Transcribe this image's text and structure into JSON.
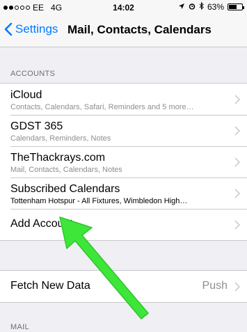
{
  "status_bar": {
    "carrier": "EE",
    "network": "4G",
    "time": "14:02",
    "battery": "63%",
    "battery_level": 0.63,
    "icons": [
      "location-arrow-icon",
      "alarm-icon",
      "bluetooth-icon"
    ]
  },
  "nav": {
    "back_label": "Settings",
    "title": "Mail, Contacts, Calendars"
  },
  "accounts": {
    "header": "ACCOUNTS",
    "items": [
      {
        "title": "iCloud",
        "subtitle": "Contacts, Calendars, Safari, Reminders and 5 more…"
      },
      {
        "title": "GDST 365",
        "subtitle": "Calendars, Reminders, Notes"
      },
      {
        "title": "TheThackrays.com",
        "subtitle": "Mail, Contacts, Calendars, Notes"
      },
      {
        "title": "Subscribed Calendars",
        "subtitle": "Tottenham Hotspur - All Fixtures, Wimbledon High…"
      },
      {
        "title": "Add Account"
      }
    ]
  },
  "fetch": {
    "label": "Fetch New Data",
    "value": "Push"
  },
  "mail_section": {
    "header": "MAIL"
  },
  "colors": {
    "accent": "#007aff",
    "arrow": "#3ee63a"
  }
}
